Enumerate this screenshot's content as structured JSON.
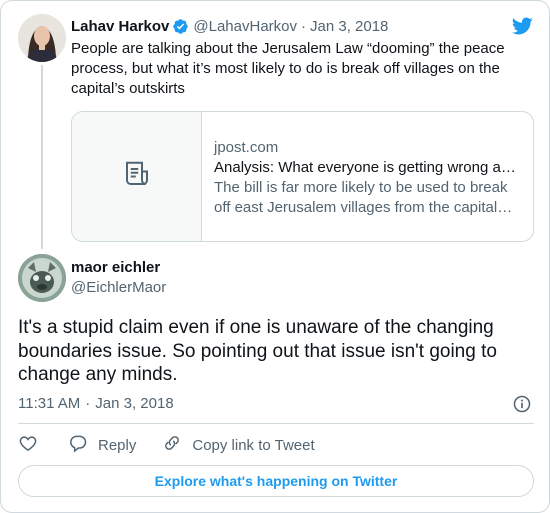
{
  "quoted_tweet": {
    "author_name": "Lahav Harkov",
    "author_handle": "@LahavHarkov",
    "separator": "·",
    "date": "Jan 3, 2018",
    "verified": true,
    "text": "People are talking about the Jerusalem Law “dooming” the peace process, but what it’s most likely to do is break off villages on the capital’s outskirts",
    "link_card": {
      "domain": "jpost.com",
      "title": "Analysis: What everyone is getting wrong about the Jerusalem bill",
      "description": "The bill is far more likely to be used to break off east Jerusalem villages from the capital than to prevent negotiations",
      "thumbnail_icon": "article-icon"
    }
  },
  "tweet": {
    "author_name": "maor eichler",
    "author_handle": "@EichlerMaor",
    "text": "It's a stupid claim even if one is unaware of the changing boundaries issue. So pointing out that issue isn't going to change any minds.",
    "time": "11:31 AM",
    "separator": "·",
    "date": "Jan 3, 2018"
  },
  "actions": {
    "like_icon": "heart-icon",
    "reply_label": "Reply",
    "copy_label": "Copy link to Tweet"
  },
  "explore_button": "Explore what's happening on Twitter",
  "colors": {
    "accent": "#1d9bf0",
    "text_primary": "#0f1419",
    "text_secondary": "#536471",
    "border": "#cfd9de"
  }
}
